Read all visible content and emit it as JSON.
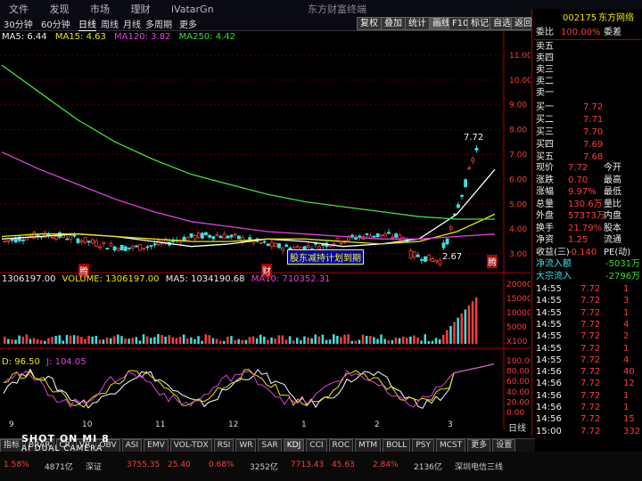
{
  "topnav": [
    "文件",
    "发现",
    "市场",
    "理财",
    "iVatarGn"
  ],
  "window_title": "东方财富终端",
  "toolbar": {
    "periods": [
      "30分钟",
      "60分钟",
      "日线",
      "周线",
      "月线",
      "多周期",
      "更多"
    ],
    "active_period": "日线",
    "right_buttons": [
      "复权",
      "叠加",
      "统计",
      "画线",
      "F10",
      "标记",
      "自选",
      "返回"
    ],
    "active_right": "画线"
  },
  "ma_header": {
    "ma5": "MA5: 6.44",
    "ma15": "MA15: 4.63",
    "ma120": "MA120: 3.82",
    "ma250": "MA250: 4.42"
  },
  "price_axis": [
    "11.00",
    "10.00",
    "9.00",
    "8.00",
    "7.00",
    "6.00",
    "5.00",
    "4.00",
    "3.00"
  ],
  "price_annotations": {
    "high": "7.72",
    "low": "2.67",
    "banner": "股东减持计划到期",
    "markers": [
      "腾",
      "财",
      "腾"
    ]
  },
  "volume_header": {
    "left": "1306197.00",
    "volume": "VOLUME: 1306197.00",
    "ma5": "MA5: 1034190.68",
    "ma10": "MA10: 710352.31"
  },
  "volume_axis": [
    "20000",
    "15000",
    "10000",
    "5000",
    "X100"
  ],
  "kdj_header": {
    "d": "D: 96.50",
    "j": "J: 104.05"
  },
  "kdj_axis": [
    "100.00",
    "80.00",
    "60.00",
    "40.00",
    "20.00",
    "0.00"
  ],
  "time_axis": [
    "9",
    "10",
    "11",
    "12",
    "1",
    "2",
    "3"
  ],
  "time_axis_right": "日线",
  "stock": {
    "code": "002175",
    "name": "东方网络"
  },
  "committee": {
    "label": "委比",
    "value": "100.00%",
    "label2": "委差",
    "value2": ""
  },
  "sell_labels": [
    "卖五",
    "卖四",
    "卖三",
    "卖二",
    "卖一"
  ],
  "buy_book": [
    {
      "label": "买一",
      "price": "7.72"
    },
    {
      "label": "买二",
      "price": "7.71"
    },
    {
      "label": "买三",
      "price": "7.70"
    },
    {
      "label": "买四",
      "price": "7.69"
    },
    {
      "label": "买五",
      "price": "7.68"
    }
  ],
  "quote": [
    {
      "l": "现价",
      "v": "7.72",
      "l2": "今开"
    },
    {
      "l": "涨跌",
      "v": "0.70",
      "l2": "最高"
    },
    {
      "l": "涨幅",
      "v": "9.97%",
      "l2": "最低"
    },
    {
      "l": "总量",
      "v": "130.6万",
      "l2": "量比"
    },
    {
      "l": "外盘",
      "v": "57373万",
      "l2": "内盘"
    },
    {
      "l": "换手",
      "v": "21.79%",
      "l2": "股本"
    },
    {
      "l": "净资",
      "v": "1.25",
      "l2": "流通"
    },
    {
      "l": "收益(三)",
      "v": "-0.140",
      "l2": "PE(动)"
    }
  ],
  "flows": [
    {
      "label": "净流入额",
      "value": "-5031万"
    },
    {
      "label": "大宗流入",
      "value": "-2796万"
    }
  ],
  "ticks": [
    {
      "t": "14:55",
      "p": "7.72",
      "v": "1"
    },
    {
      "t": "14:55",
      "p": "7.72",
      "v": "3"
    },
    {
      "t": "14:55",
      "p": "7.72",
      "v": "1"
    },
    {
      "t": "14:55",
      "p": "7.72",
      "v": "4"
    },
    {
      "t": "14:55",
      "p": "7.72",
      "v": "2"
    },
    {
      "t": "14:55",
      "p": "7.72",
      "v": "1"
    },
    {
      "t": "14:55",
      "p": "7.72",
      "v": "4"
    },
    {
      "t": "14:56",
      "p": "7.72",
      "v": "40"
    },
    {
      "t": "14:56",
      "p": "7.72",
      "v": "12"
    },
    {
      "t": "14:56",
      "p": "7.72",
      "v": "1"
    },
    {
      "t": "14:56",
      "p": "7.72",
      "v": "1"
    },
    {
      "t": "14:56",
      "p": "7.72",
      "v": "15"
    },
    {
      "t": "15:00",
      "p": "7.72",
      "v": "332"
    }
  ],
  "bottom_tabs": [
    "指标",
    "BRAR",
    "CR",
    "VR",
    "OBV",
    "ASI",
    "EMV",
    "VOL-TDX",
    "RSI",
    "WR",
    "SAR",
    "KDJ",
    "CCI",
    "ROC",
    "MTM",
    "BOLL",
    "PSY",
    "MCST",
    "更多",
    "设置"
  ],
  "active_bottom_tab": "KDJ",
  "statusbar": [
    "1.58%",
    "4871亿",
    "深证",
    "3755.35",
    "25.40",
    "0.68%",
    "3252亿",
    "7713.43",
    "45.63",
    "2.84%",
    "2136亿",
    "深圳电信三线"
  ],
  "watermark": {
    "line1": "SHOT ON MI 8",
    "line2": "AI DUAL CAMERA"
  },
  "colors": {
    "up": "#ff3b3b",
    "down": "#3ee0e0",
    "ma5": "#ffffff",
    "ma15": "#e8e800",
    "ma120": "#e040e0",
    "ma250": "#40e040"
  },
  "chart_data": {
    "type": "line",
    "title": "",
    "xlabel": "",
    "ylabel": "",
    "ylim": [
      2.5,
      11.5
    ],
    "note_points": [
      2.67,
      7.72
    ],
    "series": [
      {
        "name": "MA5",
        "values": [
          3.6,
          3.7,
          3.8,
          3.7,
          3.5,
          3.3,
          3.4,
          3.6,
          3.5,
          3.3,
          3.4,
          3.6,
          4.6,
          6.4
        ]
      },
      {
        "name": "MA15",
        "values": [
          3.7,
          3.8,
          3.8,
          3.7,
          3.6,
          3.5,
          3.5,
          3.6,
          3.6,
          3.5,
          3.4,
          3.5,
          3.9,
          4.6
        ]
      },
      {
        "name": "MA120",
        "values": [
          7.1,
          6.4,
          5.8,
          5.2,
          4.7,
          4.3,
          4.1,
          3.9,
          3.8,
          3.7,
          3.6,
          3.6,
          3.7,
          3.8
        ]
      },
      {
        "name": "MA250",
        "values": [
          10.6,
          9.5,
          8.4,
          7.5,
          6.8,
          6.2,
          5.8,
          5.4,
          5.1,
          4.9,
          4.7,
          4.5,
          4.4,
          4.4
        ]
      }
    ]
  }
}
